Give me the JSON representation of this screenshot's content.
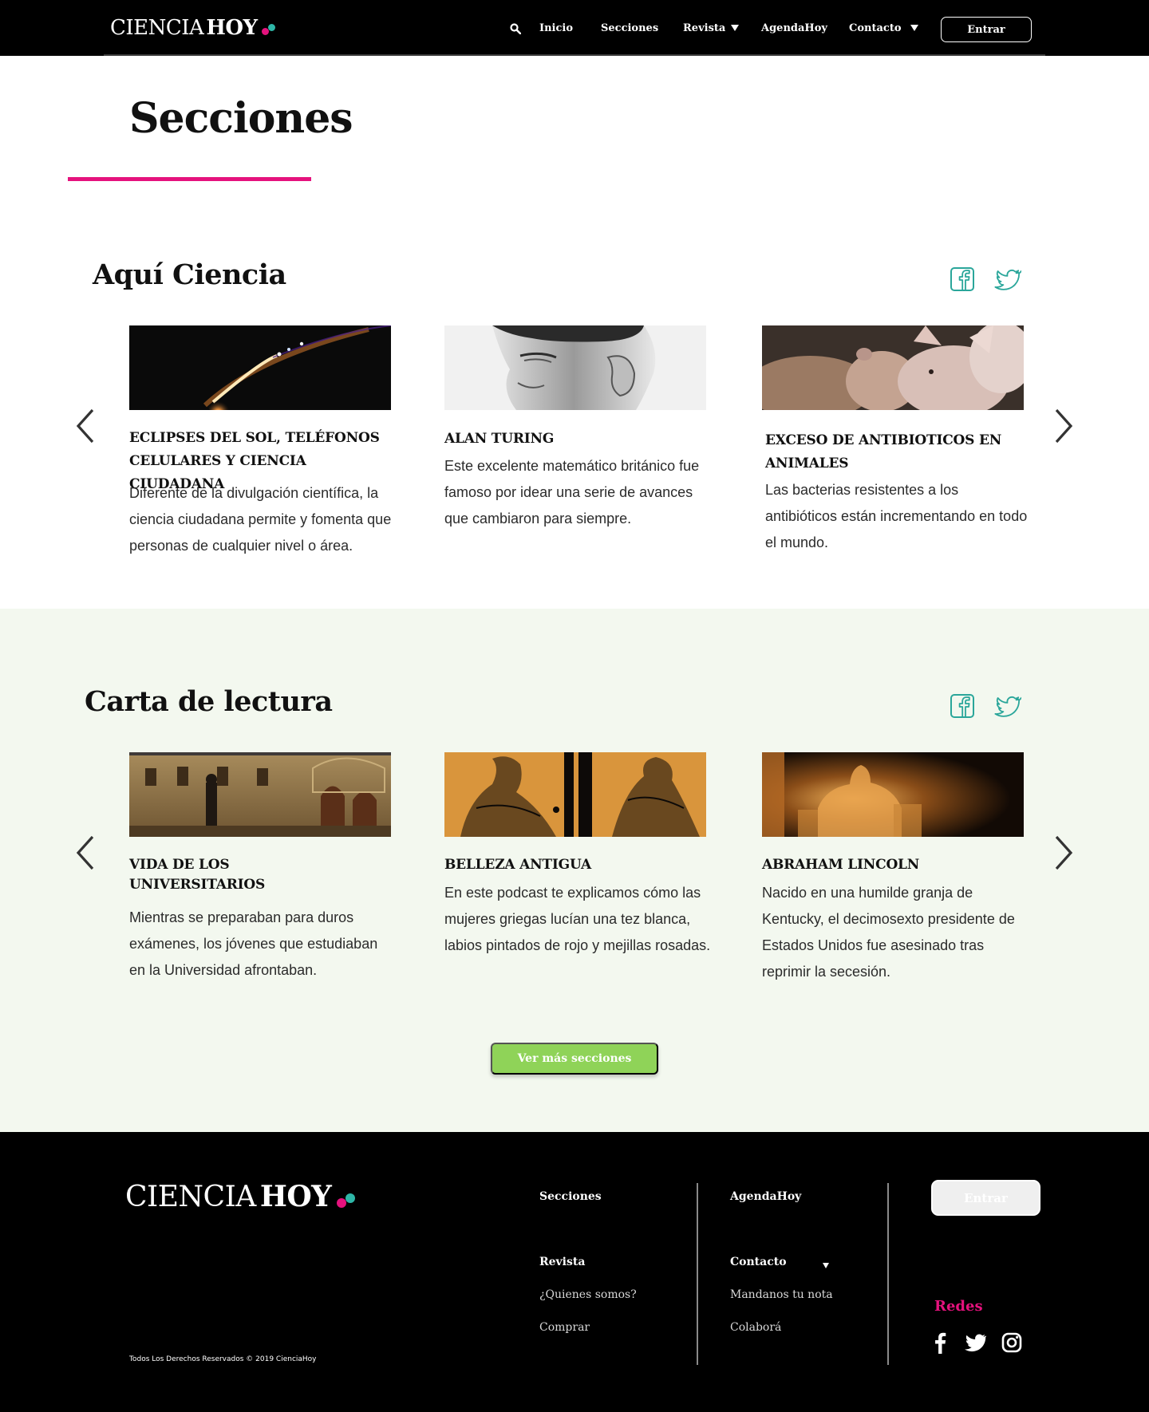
{
  "header": {
    "logo": {
      "part1": "CIENCIA",
      "part2": "HOY"
    },
    "nav": [
      {
        "label": "Inicio"
      },
      {
        "label": "Secciones"
      },
      {
        "label": "Revista"
      },
      {
        "label": "AgendaHoy"
      },
      {
        "label": "Contacto"
      }
    ],
    "login_label": "Entrar",
    "icons": {
      "search": "search-icon",
      "dropdown": "triangle-down-icon"
    }
  },
  "page": {
    "title": "Secciones",
    "accent_color": "#e5127d"
  },
  "sections": [
    {
      "title": "Aquí Ciencia",
      "cards": [
        {
          "title": "ECLIPSES DEL SOL, TELÉFONOS CELULARES Y CIENCIA CIUDADANA",
          "text": "Diferente de la divulgación científica, la ciencia ciudadana permite y fomenta que personas de cualquier nivel o área."
        },
        {
          "title": "ALAN TURING",
          "text": "Este excelente matemático británico fue famoso por idear una serie de avances que cambiaron para siempre."
        },
        {
          "title": "EXCESO DE ANTIBIOTICOS EN ANIMALES",
          "text": "Las bacterias resistentes a los antibióticos están incrementando en todo el mundo."
        }
      ]
    },
    {
      "title": "Carta de lectura",
      "cards": [
        {
          "title": "VIDA DE LOS UNIVERSITARIOS",
          "text": "Mientras se preparaban para duros exámenes, los jóvenes que estudiaban en la Universidad afrontaban."
        },
        {
          "title": "BELLEZA ANTIGUA",
          "text": "En este podcast te explicamos cómo las mujeres griegas lucían una tez blanca, labios pintados de rojo y mejillas rosadas."
        },
        {
          "title": "ABRAHAM LINCOLN",
          "text": "Nacido en una humilde granja de Kentucky, el decimosexto presidente de Estados Unidos fue asesinado tras reprimir la secesión."
        }
      ]
    }
  ],
  "more_button": {
    "label": "Ver más secciones",
    "color": "#8fd358"
  },
  "band_color": "#f3f8ef",
  "footer": {
    "logo": {
      "part1": "CIENCIA",
      "part2": "HOY"
    },
    "col1": {
      "head1": "Secciones",
      "head2": "Revista",
      "links": [
        "¿Quienes somos?",
        "Comprar"
      ]
    },
    "col2": {
      "head1": "AgendaHoy",
      "head2": "Contacto",
      "links": [
        "Mandanos tu nota",
        "Colaborá"
      ]
    },
    "login_label": "Entrar",
    "redes_label": "Redes",
    "social_icons": [
      "facebook-icon",
      "twitter-icon",
      "instagram-icon"
    ],
    "copyright": "Todos Los Derechos Reservados © 2019 CienciaHoy"
  }
}
